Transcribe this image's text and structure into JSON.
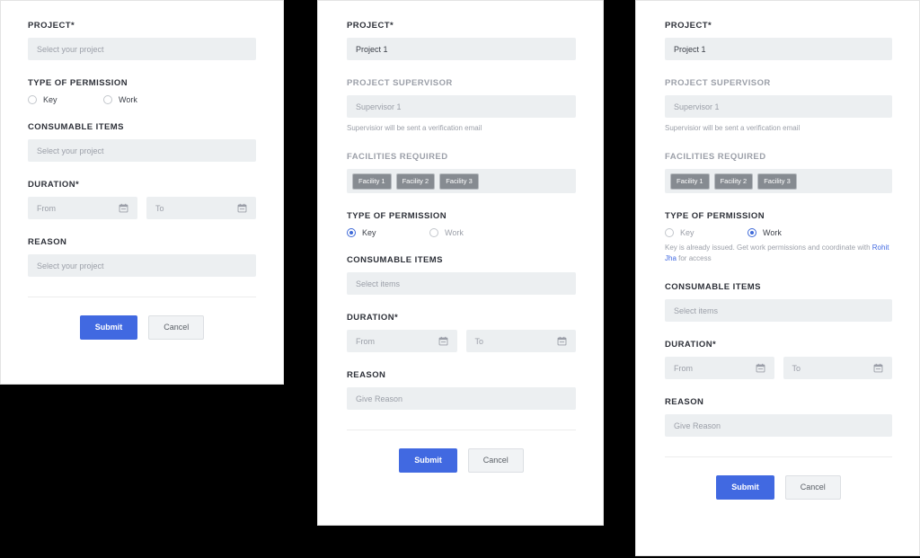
{
  "colors": {
    "accent": "#4169e1",
    "link": "#4169e1",
    "field_bg": "#eceff1",
    "chip_bg": "#868b91",
    "page_bg": "#000000",
    "panel_bg": "#ffffff",
    "label": "#2d3038",
    "muted": "#9b9fa8"
  },
  "common": {
    "labels": {
      "project": "PROJECT*",
      "project_supervisor": "PROJECT SUPERVISOR",
      "facilities_required": "FACILITIES REQUIRED",
      "type_of_permission": "TYPE OF PERMISSION",
      "consumable_items": "CONSUMABLE ITEMS",
      "duration": "DURATION*",
      "reason": "REASON"
    },
    "radio": {
      "key": "Key",
      "work": "Work"
    },
    "buttons": {
      "submit": "Submit",
      "cancel": "Cancel"
    },
    "icons": {
      "calendar": "calendar-icon"
    }
  },
  "panels": [
    {
      "id": "panel-1",
      "name": "empty-permission-form",
      "project": {
        "label": "PROJECT*",
        "value": "",
        "placeholder": "Select your project"
      },
      "permission": {
        "label": "TYPE OF PERMISSION",
        "options": [
          {
            "label": "Key",
            "selected": false
          },
          {
            "label": "Work",
            "selected": false
          }
        ]
      },
      "consumables": {
        "label": "CONSUMABLE ITEMS",
        "value": "",
        "placeholder": "Select your project"
      },
      "duration": {
        "label": "DURATION*",
        "from_placeholder": "From",
        "to_placeholder": "To",
        "from_value": "",
        "to_value": ""
      },
      "reason": {
        "label": "REASON",
        "value": "",
        "placeholder": "Select your project"
      },
      "actions": {
        "submit": "Submit",
        "cancel": "Cancel"
      }
    },
    {
      "id": "panel-2",
      "name": "key-permission-form",
      "project": {
        "label": "PROJECT*",
        "value": "Project 1",
        "placeholder": "Select your project"
      },
      "supervisor": {
        "label": "PROJECT SUPERVISOR",
        "value": "",
        "placeholder": "Supervisor 1",
        "helper": "Supervisior will be sent a verification email"
      },
      "facilities": {
        "label": "FACILITIES REQUIRED",
        "chips": [
          "Facility 1",
          "Facility 2",
          "Facility 3"
        ]
      },
      "permission": {
        "label": "TYPE OF PERMISSION",
        "options": [
          {
            "label": "Key",
            "selected": true
          },
          {
            "label": "Work",
            "selected": false
          }
        ],
        "helper": "",
        "helper_link": ""
      },
      "consumables": {
        "label": "CONSUMABLE ITEMS",
        "value": "",
        "placeholder": "Select items"
      },
      "duration": {
        "label": "DURATION*",
        "from_placeholder": "From",
        "to_placeholder": "To",
        "from_value": "",
        "to_value": ""
      },
      "reason": {
        "label": "REASON",
        "value": "",
        "placeholder": "Give Reason"
      },
      "actions": {
        "submit": "Submit",
        "cancel": "Cancel"
      }
    },
    {
      "id": "panel-3",
      "name": "work-permission-form",
      "project": {
        "label": "PROJECT*",
        "value": "Project 1",
        "placeholder": "Select your project"
      },
      "supervisor": {
        "label": "PROJECT SUPERVISOR",
        "value": "",
        "placeholder": "Supervisor 1",
        "helper": "Supervisior will be sent a verification email"
      },
      "facilities": {
        "label": "FACILITIES REQUIRED",
        "chips": [
          "Facility 1",
          "Facility 2",
          "Facility 3"
        ]
      },
      "permission": {
        "label": "TYPE OF PERMISSION",
        "options": [
          {
            "label": "Key",
            "selected": false
          },
          {
            "label": "Work",
            "selected": true
          }
        ],
        "helper_prefix": "Key is already issued. Get work permissions and coordinate with ",
        "helper_link": "Rohit Jha",
        "helper_suffix": " for access"
      },
      "consumables": {
        "label": "CONSUMABLE ITEMS",
        "value": "",
        "placeholder": "Select items"
      },
      "duration": {
        "label": "DURATION*",
        "from_placeholder": "From",
        "to_placeholder": "To",
        "from_value": "",
        "to_value": ""
      },
      "reason": {
        "label": "REASON",
        "value": "",
        "placeholder": "Give Reason"
      },
      "actions": {
        "submit": "Submit",
        "cancel": "Cancel"
      }
    }
  ]
}
